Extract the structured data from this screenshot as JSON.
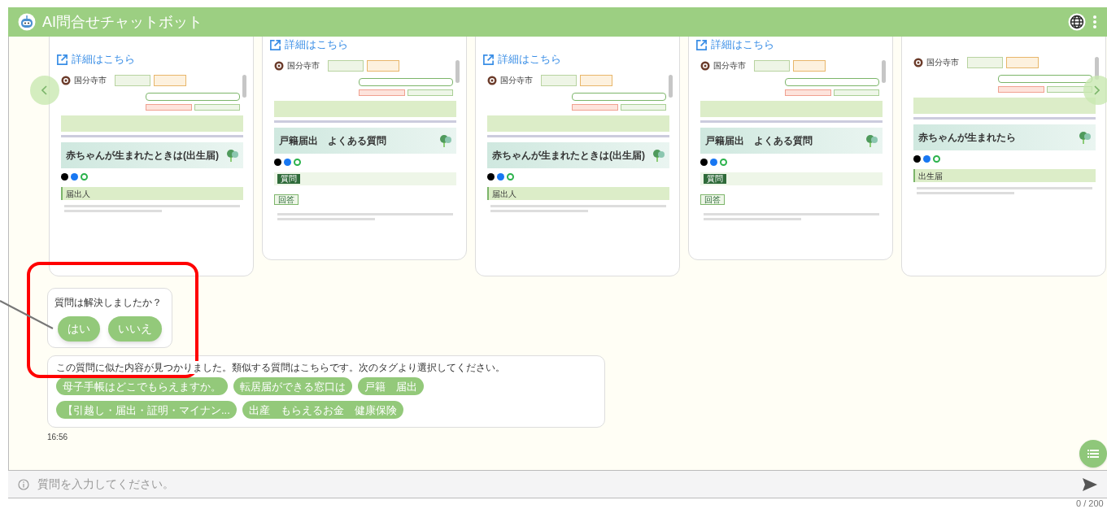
{
  "header": {
    "title": "AI問合せチャットボット"
  },
  "cards": [
    {
      "link": "詳細はこちら",
      "page": {
        "site_name": "国分寺市",
        "title": "赤ちゃんが生まれたときは(出生届)",
        "section": "届出人"
      }
    },
    {
      "link": "詳細はこちら",
      "page": {
        "site_name": "国分寺市",
        "title": "戸籍届出　よくある質問",
        "question_label": "質問",
        "answer_label": "回答"
      }
    },
    {
      "link": "詳細はこちら",
      "page": {
        "site_name": "国分寺市",
        "title": "赤ちゃんが生まれたときは(出生届)",
        "section": "届出人"
      }
    },
    {
      "link": "詳細はこちら",
      "page": {
        "site_name": "国分寺市",
        "title": "戸籍届出　よくある質問",
        "question_label": "質問",
        "answer_label": "回答"
      }
    },
    {
      "page": {
        "site_name": "国分寺市",
        "title": "赤ちゃんが生まれたら",
        "section": "出生届"
      }
    }
  ],
  "feedback": {
    "question": "質問は解決しましたか？",
    "buttons": [
      "はい",
      "いいえ"
    ]
  },
  "suggestions": {
    "message": "この質問に似た内容が見つかりました。類似する質問はこちらです。次のタグより選択してください。",
    "tags": [
      "母子手帳はどこでもらえますか。",
      "転居届ができる窓口は",
      "戸籍　届出",
      "【引越し・届出・証明・マイナン...",
      "出産　もらえるお金　健康保険"
    ],
    "time": "16:56"
  },
  "input": {
    "placeholder": "質問を入力してください。",
    "counter": "0 / 200"
  }
}
